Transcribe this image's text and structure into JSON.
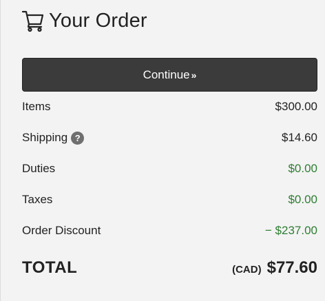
{
  "header": {
    "icon": "shopping-cart-icon",
    "title": "Your Order"
  },
  "actions": {
    "continue_label": "Continue",
    "continue_chevron": "»"
  },
  "summary": {
    "items": {
      "label": "Items",
      "value": "$300.00"
    },
    "shipping": {
      "label": "Shipping",
      "help_icon": "question-circle-icon",
      "help_glyph": "?",
      "value": "$14.60"
    },
    "duties": {
      "label": "Duties",
      "value": "$0.00"
    },
    "taxes": {
      "label": "Taxes",
      "value": "$0.00"
    },
    "discount": {
      "label": "Order Discount",
      "value": "− $237.00"
    }
  },
  "total": {
    "label": "TOTAL",
    "currency": "(CAD)",
    "amount": "$77.60"
  },
  "colors": {
    "button_bg": "#3b3b3b",
    "positive_green": "#2e7d32",
    "background": "#f3f3f3"
  }
}
